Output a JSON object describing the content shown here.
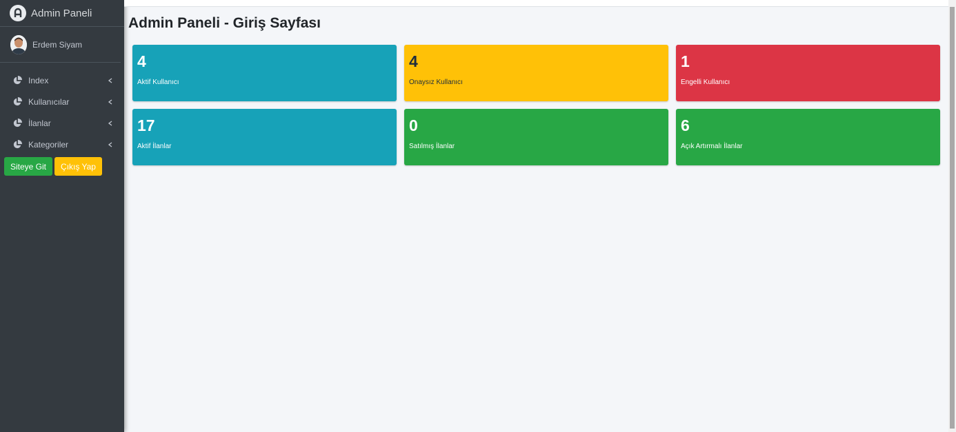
{
  "brand": {
    "title": "Admin Paneli",
    "logo_icon": "admin-logo-icon"
  },
  "user": {
    "name": "Erdem Siyam"
  },
  "sidebar": {
    "items": [
      {
        "label": "Index",
        "icon": "pie-chart-icon"
      },
      {
        "label": "Kullanıcılar",
        "icon": "pie-chart-icon"
      },
      {
        "label": "İlanlar",
        "icon": "pie-chart-icon"
      },
      {
        "label": "Kategoriler",
        "icon": "pie-chart-icon"
      }
    ],
    "buttons": {
      "site": "Siteye Git",
      "logout": "Çıkış Yap"
    }
  },
  "page": {
    "title": "Admin Paneli - Giriş Sayfası"
  },
  "stats": [
    {
      "value": "4",
      "label": "Aktif Kullanıcı",
      "color": "#17a2b8"
    },
    {
      "value": "4",
      "label": "Onaysız Kullanıcı",
      "color": "#ffc107"
    },
    {
      "value": "1",
      "label": "Engelli Kullanıcı",
      "color": "#dc3545"
    },
    {
      "value": "17",
      "label": "Aktif İlanlar",
      "color": "#17a2b8"
    },
    {
      "value": "0",
      "label": "Satılmış İlanlar",
      "color": "#28a745"
    },
    {
      "value": "6",
      "label": "Açık Artırmalı İlanlar",
      "color": "#28a745"
    }
  ]
}
